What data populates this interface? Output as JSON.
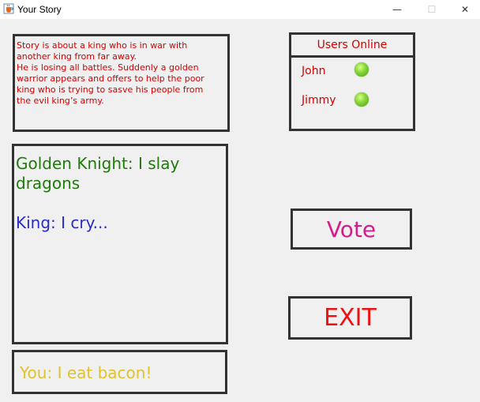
{
  "window": {
    "title": "Your Story",
    "min_glyph": "—",
    "max_glyph": "☐",
    "close_glyph": "✕",
    "app_icon": "java-cup-icon"
  },
  "story": {
    "text": "Story is about a king who is in war with\nanother king from far away.\nHe is losing all battles. Suddenly a golden\nwarrior appears and offers to help the poor\nking who is trying to sasve his people from\nthe evil king’s army."
  },
  "users_online": {
    "title": "Users Online",
    "users": [
      {
        "name": "John",
        "status": "online",
        "status_color": "#7fd02a"
      },
      {
        "name": "Jimmy",
        "status": "online",
        "status_color": "#7fd02a"
      }
    ]
  },
  "chat": {
    "messages": [
      {
        "text": "Golden Knight: I slay dragons",
        "color": "#1f7a0a"
      },
      {
        "text": "King: I cry...",
        "color": "#2a2ac8"
      }
    ]
  },
  "input": {
    "value": "You: I eat bacon!",
    "color": "#e0c22e"
  },
  "buttons": {
    "vote": "Vote",
    "exit": "EXIT"
  },
  "colors": {
    "text_red": "#d40000",
    "vote": "#d81b8a",
    "exit": "#ee1111",
    "border": "#333333",
    "background": "#f0f0f0"
  }
}
